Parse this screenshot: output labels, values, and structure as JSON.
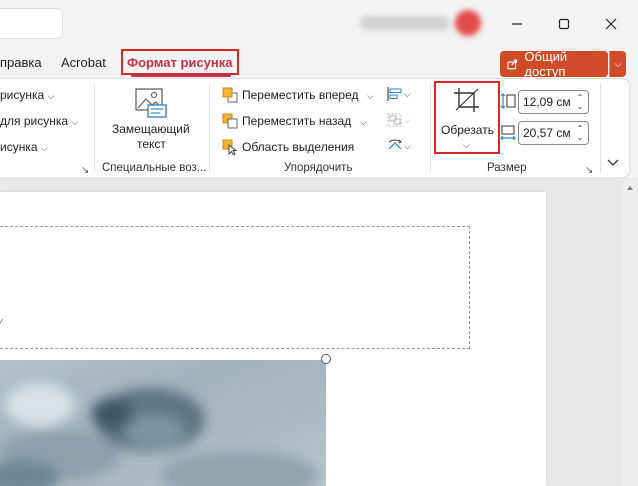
{
  "window": {
    "user_name": "",
    "minimize_icon": "minimize-icon",
    "maximize_icon": "maximize-icon",
    "close_icon": "close-icon"
  },
  "tabs": {
    "help": "правка",
    "acrobat": "Acrobat",
    "picture_format": "Формат рисунка"
  },
  "share": {
    "label": "Общий доступ",
    "accent": "#d04b2a"
  },
  "ribbon": {
    "style_group": {
      "item1": "рисунка",
      "item2": "для рисунка",
      "item3": "исунка"
    },
    "accessibility": {
      "alt_text_line1": "Замещающий",
      "alt_text_line2": "текст",
      "group_label": "Специальные воз..."
    },
    "arrange": {
      "bring_forward": "Переместить вперед",
      "send_backward": "Переместить назад",
      "selection_pane": "Область выделения",
      "group_label": "Упорядочить"
    },
    "size": {
      "crop_label": "Обрезать",
      "height": "12,09 см",
      "width": "20,57 см",
      "group_label": "Размер"
    }
  },
  "colors": {
    "highlight_border": "#d42a2a",
    "active_tab": "#c4314b"
  }
}
